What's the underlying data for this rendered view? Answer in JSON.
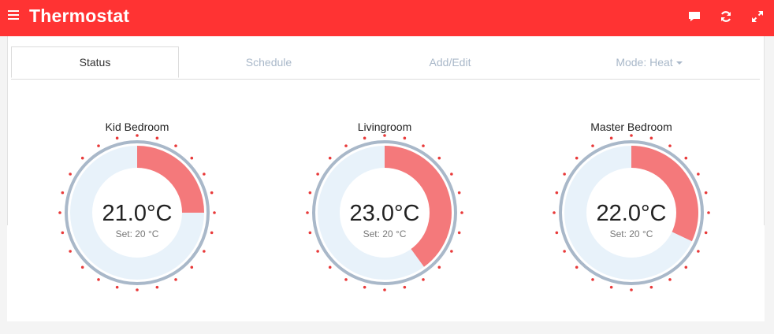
{
  "app": {
    "title": "Thermostat"
  },
  "colors": {
    "header": "#ff3333",
    "dial_fill": "#f4797b",
    "dial_bg": "#e8f2fa",
    "dial_ring": "#a9b8c9",
    "tick": "#e83a3a"
  },
  "icons": {
    "menu": "hamburger-icon",
    "chat": "chat-bubble-icon",
    "refresh": "refresh-icon",
    "expand": "expand-icon"
  },
  "tabs": {
    "status": "Status",
    "schedule": "Schedule",
    "add_edit": "Add/Edit",
    "mode": "Mode: Heat"
  },
  "zones": [
    {
      "name": "Kid Bedroom",
      "temp": "21.0°C",
      "set": "Set: 20 °C",
      "fill_fraction": 0.25
    },
    {
      "name": "Livingroom",
      "temp": "23.0°C",
      "set": "Set: 20 °C",
      "fill_fraction": 0.4
    },
    {
      "name": "Master Bedroom",
      "temp": "22.0°C",
      "set": "Set: 20 °C",
      "fill_fraction": 0.32
    }
  ]
}
